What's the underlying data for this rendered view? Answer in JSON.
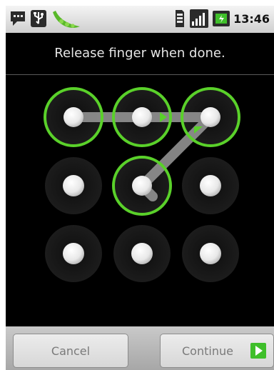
{
  "status_bar": {
    "clock": "13:46",
    "icons": [
      "talk-notification-icon",
      "usb-icon",
      "pea-pod-icon",
      "sim-icon",
      "signal-icon",
      "battery-icon"
    ]
  },
  "header": {
    "title": "Release finger when done."
  },
  "pattern": {
    "grid_size": 3,
    "selected_dots": [
      0,
      1,
      2,
      4
    ],
    "accent_color": "#5ad12a",
    "path_color": "#9a9a9a"
  },
  "footer": {
    "cancel_label": "Cancel",
    "continue_label": "Continue"
  }
}
